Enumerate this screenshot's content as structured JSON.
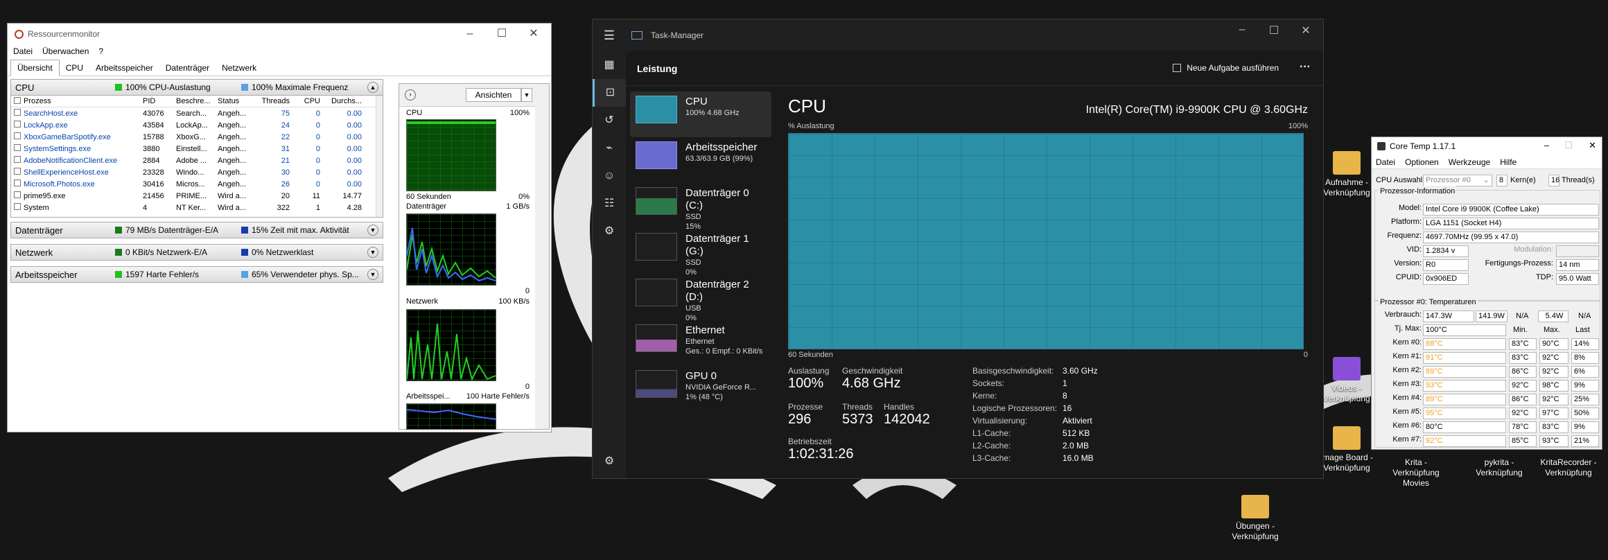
{
  "desktop": {
    "icons": [
      {
        "label": "Aufnahme - Verknüpfung"
      },
      {
        "label": "Videos - Verknüpfung"
      },
      {
        "label": "Image Board - Verknüpfung"
      },
      {
        "label": "Krita - Verknüpfung Movies"
      },
      {
        "label": "pykrita - Verknüpfung"
      },
      {
        "label": "KritaRecorder - Verknüpfung"
      },
      {
        "label": "Übungen - Verknüpfung"
      }
    ]
  },
  "resmon": {
    "title": "Ressourcenmonitor",
    "menu": [
      "Datei",
      "Überwachen",
      "?"
    ],
    "tabs": [
      "Übersicht",
      "CPU",
      "Arbeitsspeicher",
      "Datenträger",
      "Netzwerk"
    ],
    "cpu": {
      "name": "CPU",
      "m1": "100% CPU-Auslastung",
      "m2": "100% Maximale Frequenz",
      "c1": "#22c022",
      "c2": "#5aa0e6"
    },
    "table": {
      "headers": [
        "Prozess",
        "PID",
        "Beschre...",
        "Status",
        "Threads",
        "CPU",
        "Durchs..."
      ],
      "rows": [
        [
          "SearchHost.exe",
          "43076",
          "Search...",
          "Angeh...",
          "75",
          "0",
          "0.00"
        ],
        [
          "LockApp.exe",
          "43584",
          "LockAp...",
          "Angeh...",
          "24",
          "0",
          "0.00"
        ],
        [
          "XboxGameBarSpotify.exe",
          "15788",
          "XboxG...",
          "Angeh...",
          "22",
          "0",
          "0.00"
        ],
        [
          "SystemSettings.exe",
          "3880",
          "Einstell...",
          "Angeh...",
          "31",
          "0",
          "0.00"
        ],
        [
          "AdobeNotificationClient.exe",
          "2884",
          "Adobe ...",
          "Angeh...",
          "21",
          "0",
          "0.00"
        ],
        [
          "ShellExperienceHost.exe",
          "23328",
          "Windo...",
          "Angeh...",
          "30",
          "0",
          "0.00"
        ],
        [
          "Microsoft.Photos.exe",
          "30416",
          "Micros...",
          "Angeh...",
          "26",
          "0",
          "0.00"
        ],
        [
          "prime95.exe",
          "21456",
          "PRIME...",
          "Wird a...",
          "20",
          "11",
          "14.77"
        ],
        [
          "System",
          "4",
          "NT Ker...",
          "Wird a...",
          "322",
          "1",
          "4.28"
        ]
      ]
    },
    "sections": [
      {
        "name": "Datenträger",
        "m1": "79 MB/s Datenträger-E/A",
        "m2": "15% Zeit mit max. Aktivität",
        "c1": "#1a7a1a",
        "c2": "#1a3ab0"
      },
      {
        "name": "Netzwerk",
        "m1": "0 KBit/s Netzwerk-E/A",
        "m2": "0% Netzwerklast",
        "c1": "#1a7a1a",
        "c2": "#1a3ab0"
      },
      {
        "name": "Arbeitsspeicher",
        "m1": "1597 Harte Fehler/s",
        "m2": "65% Verwendeter phys. Sp...",
        "c1": "#22c022",
        "c2": "#5aa0e6"
      }
    ],
    "side": {
      "view_button": "Ansichten",
      "graphs": [
        {
          "label": "CPU",
          "max": "100%",
          "foot_left": "60 Sekunden",
          "foot_right": "0%"
        },
        {
          "label": "Datenträger",
          "max": "1 GB/s",
          "foot_left": "",
          "foot_right": "0"
        },
        {
          "label": "Netzwerk",
          "max": "100 KB/s",
          "foot_left": "",
          "foot_right": "0"
        },
        {
          "label": "Arbeitsspei...",
          "max": "100 Harte Fehler/s",
          "foot_left": "",
          "foot_right": ""
        }
      ]
    }
  },
  "taskmgr": {
    "title": "Task-Manager",
    "page": "Leistung",
    "run_task": "Neue Aufgabe ausführen",
    "more": "···",
    "items": [
      {
        "title": "CPU",
        "line1": "100% 4.68 GHz",
        "line2": "",
        "line3": ""
      },
      {
        "title": "Arbeitsspeicher",
        "line1": "63.3/63.9 GB (99%)",
        "line2": "",
        "line3": ""
      },
      {
        "title": "Datenträger 0 (C:)",
        "line1": "SSD",
        "line2": "15%",
        "line3": ""
      },
      {
        "title": "Datenträger 1 (G:)",
        "line1": "SSD",
        "line2": "0%",
        "line3": ""
      },
      {
        "title": "Datenträger 2 (D:)",
        "line1": "USB",
        "line2": "0%",
        "line3": ""
      },
      {
        "title": "Ethernet",
        "line1": "Ethernet",
        "line2": "Ges.: 0 Empf.: 0 KBit/s",
        "line3": ""
      },
      {
        "title": "GPU 0",
        "line1": "NVIDIA GeForce R...",
        "line2": "1% (48 °C)",
        "line3": ""
      }
    ],
    "main": {
      "heading": "CPU",
      "model": "Intel(R) Core(TM) i9-9900K CPU @ 3.60GHz",
      "util_label": "% Auslastung",
      "util_max": "100%",
      "graph_left": "60 Sekunden",
      "graph_right": "0",
      "stats": {
        "util_lbl": "Auslastung",
        "util": "100%",
        "speed_lbl": "Geschwindigkeit",
        "speed": "4.68 GHz",
        "proc_lbl": "Prozesse",
        "proc": "296",
        "threads_lbl": "Threads",
        "threads": "5373",
        "handles_lbl": "Handles",
        "handles": "142042",
        "uptime_lbl": "Betriebszeit",
        "uptime": "1:02:31:26"
      },
      "details": [
        [
          "Basisgeschwindigkeit:",
          "3.60 GHz"
        ],
        [
          "Sockets:",
          "1"
        ],
        [
          "Kerne:",
          "8"
        ],
        [
          "Logische Prozessoren:",
          "16"
        ],
        [
          "Virtualisierung:",
          "Aktiviert"
        ],
        [
          "L1-Cache:",
          "512 KB"
        ],
        [
          "L2-Cache:",
          "2.0 MB"
        ],
        [
          "L3-Cache:",
          "16.0 MB"
        ]
      ],
      "graph_color": "#2b8fa6"
    }
  },
  "coretemp": {
    "title": "Core Temp 1.17.1",
    "menu": [
      "Datei",
      "Optionen",
      "Werkzeuge",
      "Hilfe"
    ],
    "cpu_select_lbl": "CPU Auswahl:",
    "cpu_select": "Prozessor #0",
    "cores": "8",
    "cores_lbl": "Kern(e)",
    "threads": "16",
    "threads_lbl": "Thread(s)",
    "info_title": "Prozessor-Information",
    "model_lbl": "Model:",
    "model": "Intel Core i9 9900K (Coffee Lake)",
    "platform_lbl": "Platform:",
    "platform": "LGA 1151 (Socket H4)",
    "freq_lbl": "Frequenz:",
    "freq": "4697.70MHz (99.95 x 47.0)",
    "vid_lbl": "VID:",
    "vid": "1.2834 v",
    "mod_lbl": "Modulation:",
    "rev_lbl": "Version:",
    "rev": "R0",
    "lith_lbl": "Fertigungs-Prozess:",
    "lith": "14 nm",
    "cpuid_lbl": "CPUID:",
    "cpuid": "0x906ED",
    "tdp_lbl": "TDP:",
    "tdp": "95.0 Watt",
    "temp_title": "Prozessor #0: Temperaturen",
    "power_lbl": "Verbrauch:",
    "power": [
      "147.3W",
      "141.9W",
      "N/A",
      "5.4W",
      "N/A"
    ],
    "tjmax_lbl": "Tj. Max:",
    "tjmax": "100°C",
    "col_heads": [
      "Min.",
      "Max.",
      "Last"
    ],
    "cores_rows": [
      {
        "name": "Kern #0:",
        "temp": "88°C",
        "min": "83°C",
        "max": "90°C",
        "load": "14%",
        "hot": true
      },
      {
        "name": "Kern #1:",
        "temp": "91°C",
        "min": "83°C",
        "max": "92°C",
        "load": "8%",
        "hot": true
      },
      {
        "name": "Kern #2:",
        "temp": "89°C",
        "min": "86°C",
        "max": "92°C",
        "load": "6%",
        "hot": true
      },
      {
        "name": "Kern #3:",
        "temp": "93°C",
        "min": "92°C",
        "max": "98°C",
        "load": "9%",
        "hot": true
      },
      {
        "name": "Kern #4:",
        "temp": "89°C",
        "min": "86°C",
        "max": "92°C",
        "load": "25%",
        "hot": true
      },
      {
        "name": "Kern #5:",
        "temp": "95°C",
        "min": "92°C",
        "max": "97°C",
        "load": "50%",
        "hot": true
      },
      {
        "name": "Kern #6:",
        "temp": "80°C",
        "min": "78°C",
        "max": "83°C",
        "load": "9%",
        "hot": false
      },
      {
        "name": "Kern #7:",
        "temp": "92°C",
        "min": "85°C",
        "max": "93°C",
        "load": "21%",
        "hot": true
      }
    ]
  }
}
